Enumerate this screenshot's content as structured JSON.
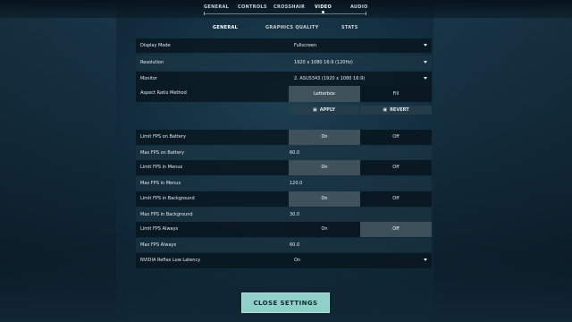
{
  "nav": {
    "tabs": [
      {
        "label": "GENERAL"
      },
      {
        "label": "CONTROLS"
      },
      {
        "label": "CROSSHAIR"
      },
      {
        "label": "VIDEO"
      },
      {
        "label": "AUDIO"
      }
    ],
    "active_tab": "VIDEO"
  },
  "subnav": {
    "tabs": [
      {
        "label": "GENERAL"
      },
      {
        "label": "GRAPHICS QUALITY"
      },
      {
        "label": "STATS"
      }
    ],
    "active_tab": "GENERAL"
  },
  "settings": {
    "display_mode": {
      "label": "Display Mode",
      "value": "Fullscreen"
    },
    "resolution": {
      "label": "Resolution",
      "value": "1920 x 1080 16:9 (120Hz)"
    },
    "monitor": {
      "label": "Monitor",
      "value": "2. ASUS343 (1920 x 1080 16:9)"
    },
    "aspect_ratio": {
      "label": "Aspect Ratio Method",
      "options": [
        "Letterbox",
        "Fill"
      ],
      "selected": "Letterbox"
    },
    "apply_label": "APPLY",
    "revert_label": "REVERT",
    "limit_fps_battery": {
      "label": "Limit FPS on Battery",
      "on": "On",
      "off": "Off",
      "selected": "On"
    },
    "max_fps_battery": {
      "label": "Max FPS on Battery",
      "value": "60.0"
    },
    "limit_fps_menus": {
      "label": "Limit FPS in Menus",
      "on": "On",
      "off": "Off",
      "selected": "On"
    },
    "max_fps_menus": {
      "label": "Max FPS in Menus",
      "value": "120.0"
    },
    "limit_fps_background": {
      "label": "Limit FPS in Background",
      "on": "On",
      "off": "Off",
      "selected": "On"
    },
    "max_fps_background": {
      "label": "Max FPS in Background",
      "value": "30.0"
    },
    "limit_fps_always": {
      "label": "Limit FPS Always",
      "on": "On",
      "off": "Off",
      "selected": "Off"
    },
    "max_fps_always": {
      "label": "Max FPS Always",
      "value": "60.0"
    },
    "nvidia_reflex": {
      "label": "NVIDIA Reflex Low Latency",
      "value": "On"
    }
  },
  "close_button": {
    "label": "CLOSE SETTINGS"
  },
  "colors": {
    "accent": "#8fd1c8",
    "panel_dark": "#09161e",
    "selected_segment": "#5f7078"
  },
  "icons": {
    "apply": "save-icon",
    "revert": "revert-icon",
    "dropdown": "chevron-down-icon"
  }
}
